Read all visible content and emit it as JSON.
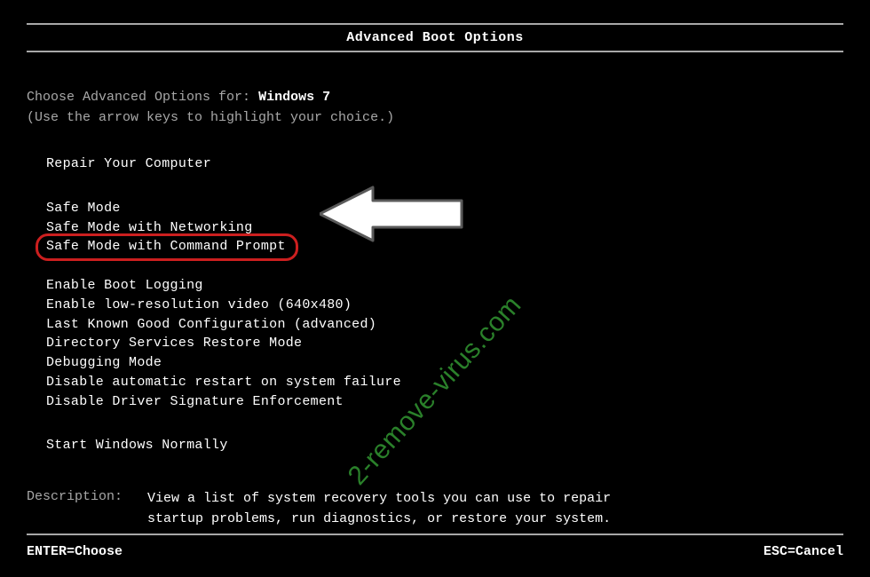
{
  "title": "Advanced Boot Options",
  "intro": {
    "prefix": "Choose Advanced Options for:",
    "os": "Windows 7",
    "hint": "(Use the arrow keys to highlight your choice.)"
  },
  "menu": {
    "group1": [
      "Repair Your Computer"
    ],
    "group2": [
      "Safe Mode",
      "Safe Mode with Networking",
      "Safe Mode with Command Prompt"
    ],
    "group3": [
      "Enable Boot Logging",
      "Enable low-resolution video (640x480)",
      "Last Known Good Configuration (advanced)",
      "Directory Services Restore Mode",
      "Debugging Mode",
      "Disable automatic restart on system failure",
      "Disable Driver Signature Enforcement"
    ],
    "group4": [
      "Start Windows Normally"
    ]
  },
  "highlighted_index": 2,
  "description": {
    "label": "Description:",
    "text": "View a list of system recovery tools you can use to repair startup problems, run diagnostics, or restore your system."
  },
  "footer": {
    "left": "ENTER=Choose",
    "right": "ESC=Cancel"
  },
  "watermark": "2-remove-virus.com",
  "colors": {
    "ring": "#cc1f1f",
    "arrow_fill": "#ffffff",
    "arrow_stroke": "#5a5a5a"
  }
}
